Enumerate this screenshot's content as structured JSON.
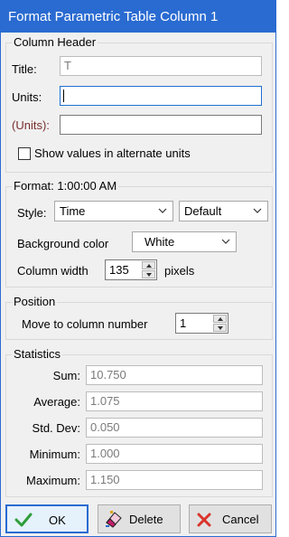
{
  "window": {
    "title": "Format Parametric Table Column 1"
  },
  "column_header": {
    "legend": "Column Header",
    "title_label": "Title:",
    "title_value": "T",
    "units_label": "Units:",
    "units_value": "",
    "alt_units_label": "(Units):",
    "alt_units_value": "",
    "show_alt_units_label": "Show values in alternate units",
    "show_alt_units_checked": false
  },
  "format": {
    "legend": "Format: 1:00:00 AM",
    "style_label": "Style:",
    "style_value": "Time",
    "style2_value": "Default",
    "bg_label": "Background color",
    "bg_value": "White",
    "width_label": "Column width",
    "width_value": "135",
    "width_unit": "pixels"
  },
  "position": {
    "legend": "Position",
    "move_label": "Move to column number",
    "move_value": "1"
  },
  "statistics": {
    "legend": "Statistics",
    "rows": [
      {
        "label": "Sum:",
        "value": "10.750"
      },
      {
        "label": "Average:",
        "value": "1.075"
      },
      {
        "label": "Std. Dev:",
        "value": "0.050"
      },
      {
        "label": "Minimum:",
        "value": "1.000"
      },
      {
        "label": "Maximum:",
        "value": "1.150"
      }
    ]
  },
  "buttons": {
    "ok": "OK",
    "delete": "Delete",
    "cancel": "Cancel"
  },
  "colors": {
    "titlebar": "#2a6bd1",
    "ok_check": "#2e9e3a",
    "cancel_x": "#d9342b",
    "alt_units_label": "#7a2e2e"
  },
  "icons": {
    "ok": "check-icon",
    "delete": "eraser-icon",
    "cancel": "x-icon"
  }
}
